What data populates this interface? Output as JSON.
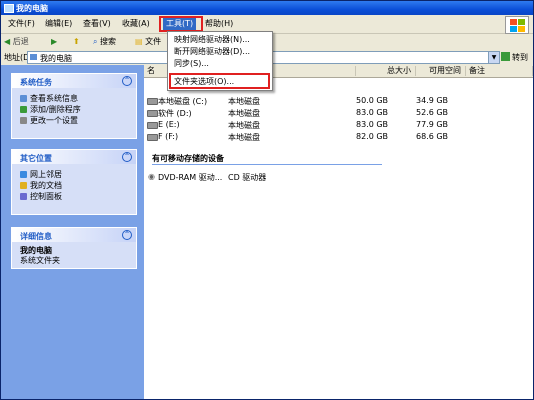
{
  "window": {
    "title": "我的电脑"
  },
  "menubar": {
    "items": [
      "文件(F)",
      "编辑(E)",
      "查看(V)",
      "收藏(A)",
      "工具(T)",
      "帮助(H)"
    ]
  },
  "tools_menu": {
    "items": [
      "映射网络驱动器(N)...",
      "断开网络驱动器(D)...",
      "同步(S)...",
      "文件夹选项(O)..."
    ]
  },
  "toolbar": {
    "back": "后退",
    "search": "搜索",
    "folders": "文件"
  },
  "address": {
    "label": "地址(D)",
    "value": "我的电脑",
    "go": "转到"
  },
  "left_panels": {
    "system_tasks": {
      "title": "系统任务",
      "items": [
        "查看系统信息",
        "添加/删除程序",
        "更改一个设置"
      ]
    },
    "other_places": {
      "title": "其它位置",
      "items": [
        "网上邻居",
        "我的文档",
        "控制面板"
      ]
    },
    "details": {
      "title": "详细信息",
      "name": "我的电脑",
      "type": "系统文件夹"
    }
  },
  "columns": {
    "name": "名",
    "type": "",
    "total_size": "总大小",
    "free_space": "可用空间",
    "comments": "备注"
  },
  "drives": [
    {
      "name": "本地磁盘 (C:)",
      "type": "本地磁盘",
      "total": "50.0 GB",
      "free": "34.9 GB"
    },
    {
      "name": "软件 (D:)",
      "type": "本地磁盘",
      "total": "83.0 GB",
      "free": "52.6 GB"
    },
    {
      "name": "E (E:)",
      "type": "本地磁盘",
      "total": "83.0 GB",
      "free": "77.9 GB"
    },
    {
      "name": "F (F:)",
      "type": "本地磁盘",
      "total": "82.0 GB",
      "free": "68.6 GB"
    }
  ],
  "removable": {
    "title": "有可移动存储的设备",
    "items": [
      {
        "name": "DVD-RAM 驱动...",
        "type": "CD 驱动器"
      }
    ]
  },
  "colors": {
    "title_blue": "#0b4fd8",
    "task_pane": "#7aa1e6",
    "highlight": "#316ac5",
    "red_box": "#e02020"
  }
}
